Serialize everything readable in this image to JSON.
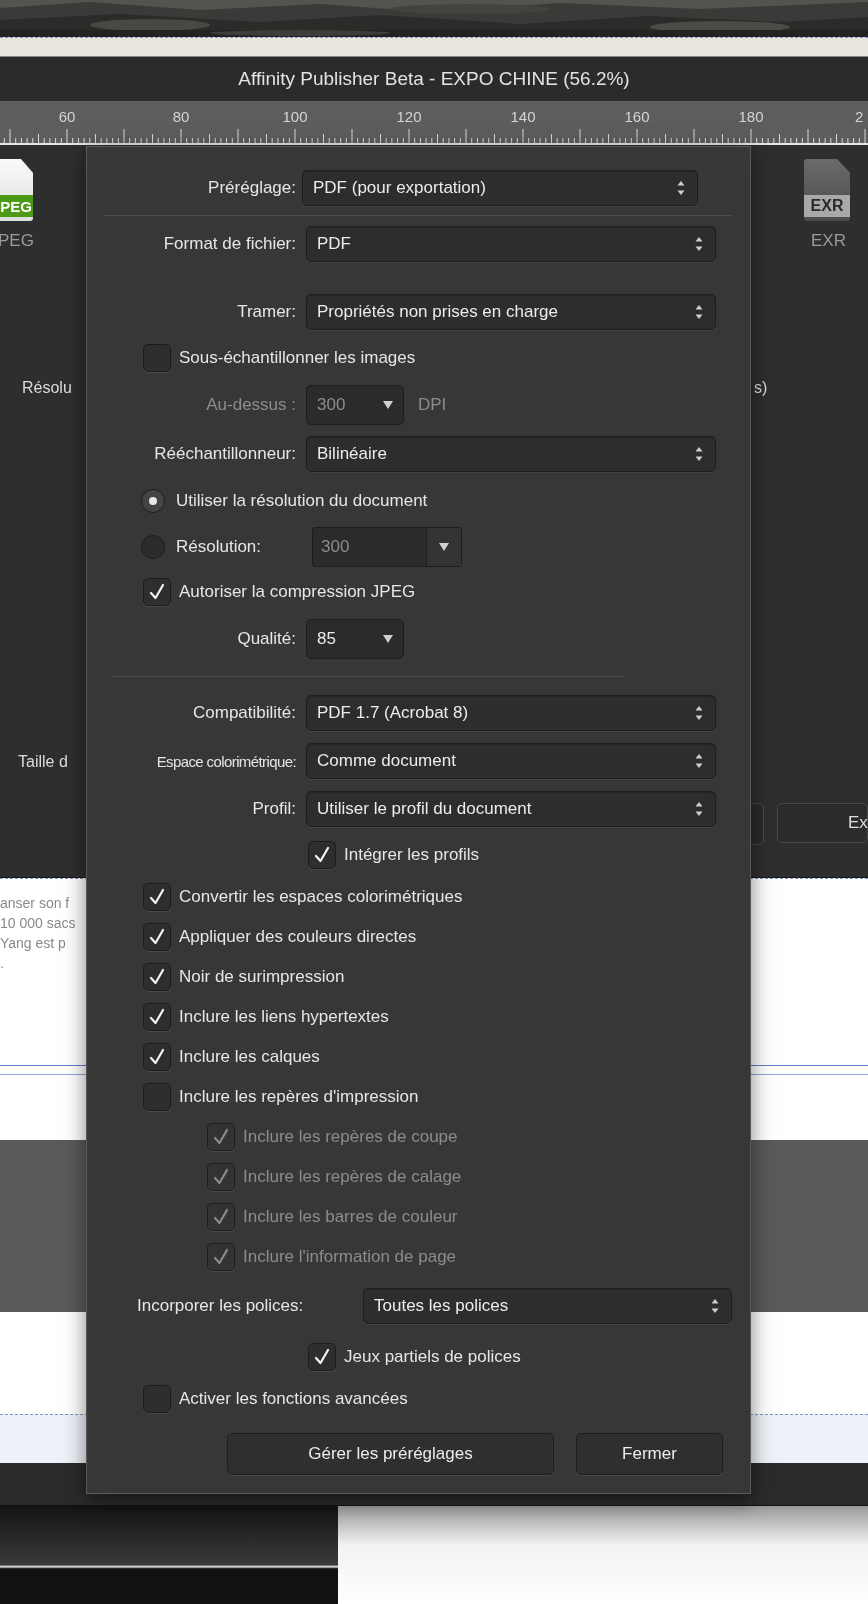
{
  "window": {
    "title": "Affinity Publisher Beta - EXPO CHINE (56.2%)"
  },
  "ruler": {
    "labels": [
      "60",
      "80",
      "100",
      "120",
      "140",
      "160",
      "180",
      "2"
    ]
  },
  "export_panel": {
    "formats": [
      {
        "label": "PEG",
        "icon_text": "PEG",
        "color": "#4e9a16"
      },
      {
        "label": "EXR",
        "icon_text": "EXR",
        "color": "#a9a9a9"
      }
    ],
    "left_labels": [
      "Résolu",
      "Taille d"
    ],
    "right_text": "s)",
    "buttons": [
      "Ex"
    ]
  },
  "document": {
    "text_lines": [
      "anser son f",
      "10 000 sacs",
      "Yang est p",
      "."
    ]
  },
  "dialog": {
    "sections": [
      [
        {
          "kind": "select",
          "label": "Préréglage:",
          "value": "PDF (pour exportation)"
        }
      ],
      [
        {
          "kind": "select",
          "label": "Format de fichier:",
          "value": "PDF"
        },
        {
          "kind": "select",
          "label": "Tramer:",
          "value": "Propriétés non prises en charge"
        },
        {
          "kind": "checkbox",
          "label": "Sous-échantillonner les images",
          "checked": false
        },
        {
          "kind": "combo",
          "label": "Au-dessus :",
          "value": "300",
          "unit": "DPI",
          "disabled": true
        },
        {
          "kind": "select",
          "label": "Rééchantillonneur:",
          "value": "Bilinéaire"
        },
        {
          "kind": "radio",
          "label": "Utiliser la résolution du document",
          "selected": true
        },
        {
          "kind": "radio",
          "label": "Résolution:",
          "selected": false,
          "value": "300",
          "disabled": true
        },
        {
          "kind": "checkbox",
          "label": "Autoriser la compression JPEG",
          "checked": true
        },
        {
          "kind": "combo",
          "label": "Qualité:",
          "value": "85",
          "disabled": false
        }
      ],
      [
        {
          "kind": "select",
          "label": "Compatibilité:",
          "value": "PDF 1.7 (Acrobat 8)"
        },
        {
          "kind": "select",
          "label": "Espace colorimétrique:",
          "value": "Comme document"
        },
        {
          "kind": "select",
          "label": "Profil:",
          "value": "Utiliser le profil du document"
        },
        {
          "kind": "option-checkbox",
          "label": "Intégrer les profils",
          "checked": true
        },
        {
          "kind": "checkbox",
          "label": "Convertir les espaces colorimétriques",
          "checked": true
        },
        {
          "kind": "checkbox",
          "label": "Appliquer des couleurs directes",
          "checked": true
        },
        {
          "kind": "checkbox",
          "label": "Noir de surimpression",
          "checked": true
        },
        {
          "kind": "checkbox",
          "label": "Inclure les liens hypertextes",
          "checked": true
        },
        {
          "kind": "checkbox",
          "label": "Inclure les calques",
          "checked": true
        },
        {
          "kind": "checkbox",
          "label": "Inclure les repères d'impression",
          "checked": false,
          "children": [
            {
              "kind": "checkbox",
              "label": "Inclure les repères de coupe",
              "checked": true,
              "disabled": true
            },
            {
              "kind": "checkbox",
              "label": "Inclure les repères de calage",
              "checked": true,
              "disabled": true
            },
            {
              "kind": "checkbox",
              "label": "Inclure les barres de couleur",
              "checked": true,
              "disabled": true
            },
            {
              "kind": "checkbox",
              "label": "Inclure l'information de page",
              "checked": true,
              "disabled": true
            }
          ]
        },
        {
          "kind": "wide-select",
          "label": "Incorporer les polices:",
          "value": "Toutes les polices"
        },
        {
          "kind": "option-checkbox",
          "label": "Jeux partiels de polices",
          "checked": true
        },
        {
          "kind": "checkbox",
          "label": "Activer les fonctions avancées",
          "checked": false
        }
      ]
    ],
    "buttons": [
      "Gérer les préréglages",
      "Fermer"
    ]
  }
}
